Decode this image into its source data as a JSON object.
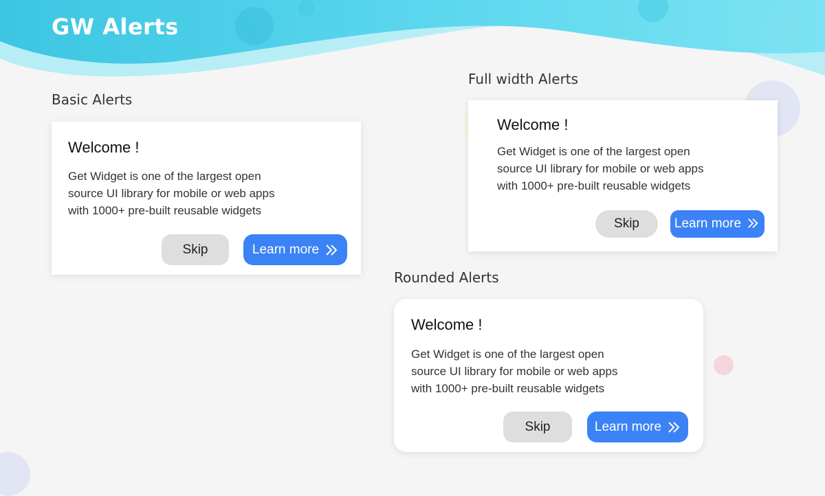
{
  "app": {
    "title": "GW Alerts"
  },
  "colors": {
    "primary": "#3b82f6",
    "skip": "#dedede",
    "header": "#4fd3ea",
    "background": "#f5f5f5"
  },
  "sections": {
    "basic": {
      "title": "Basic Alerts",
      "alert": {
        "title": "Welcome !",
        "lines": [
          "Get Widget is one of the largest open",
          "source UI library for mobile or web apps",
          "with 1000+ pre-built reusable widgets"
        ],
        "skip_label": "Skip",
        "learn_label": "Learn more",
        "learn_icon": "double-chevron-right-icon"
      }
    },
    "full_width": {
      "title": "Full width Alerts",
      "alert": {
        "title": "Welcome !",
        "lines": [
          "Get Widget is one of the largest open",
          "source UI library for mobile or web apps",
          "with 1000+ pre-built reusable widgets"
        ],
        "skip_label": "Skip",
        "learn_label": "Learn more",
        "learn_icon": "double-chevron-right-icon"
      }
    },
    "rounded": {
      "title": "Rounded Alerts",
      "alert": {
        "title": "Welcome !",
        "lines": [
          "Get Widget is one of the largest open",
          "source UI library for mobile or web apps",
          "with 1000+ pre-built reusable widgets"
        ],
        "skip_label": "Skip",
        "learn_label": "Learn more",
        "learn_icon": "double-chevron-right-icon"
      }
    }
  }
}
